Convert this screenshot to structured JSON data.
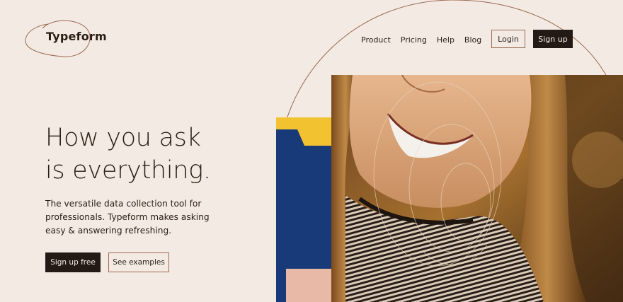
{
  "header": {
    "logo_text": "Typeform",
    "nav": {
      "product": "Product",
      "pricing": "Pricing",
      "help": "Help",
      "blog": "Blog"
    },
    "login_label": "Login",
    "signup_label": "Sign up"
  },
  "hero": {
    "headline_line1": "How you ask",
    "headline_line2": "is everything.",
    "subcopy": "The versatile data collection tool for professionals. Typeform makes asking easy & answering refreshing.",
    "primary_cta": "Sign up free",
    "secondary_cta": "See examples"
  },
  "colors": {
    "background": "#f3ebe3",
    "ink": "#2b1d14",
    "accent_line": "#9d6851",
    "dark_button": "#241a15",
    "blue": "#183a78",
    "yellow": "#f2c230",
    "peach": "#e9b9a7"
  }
}
